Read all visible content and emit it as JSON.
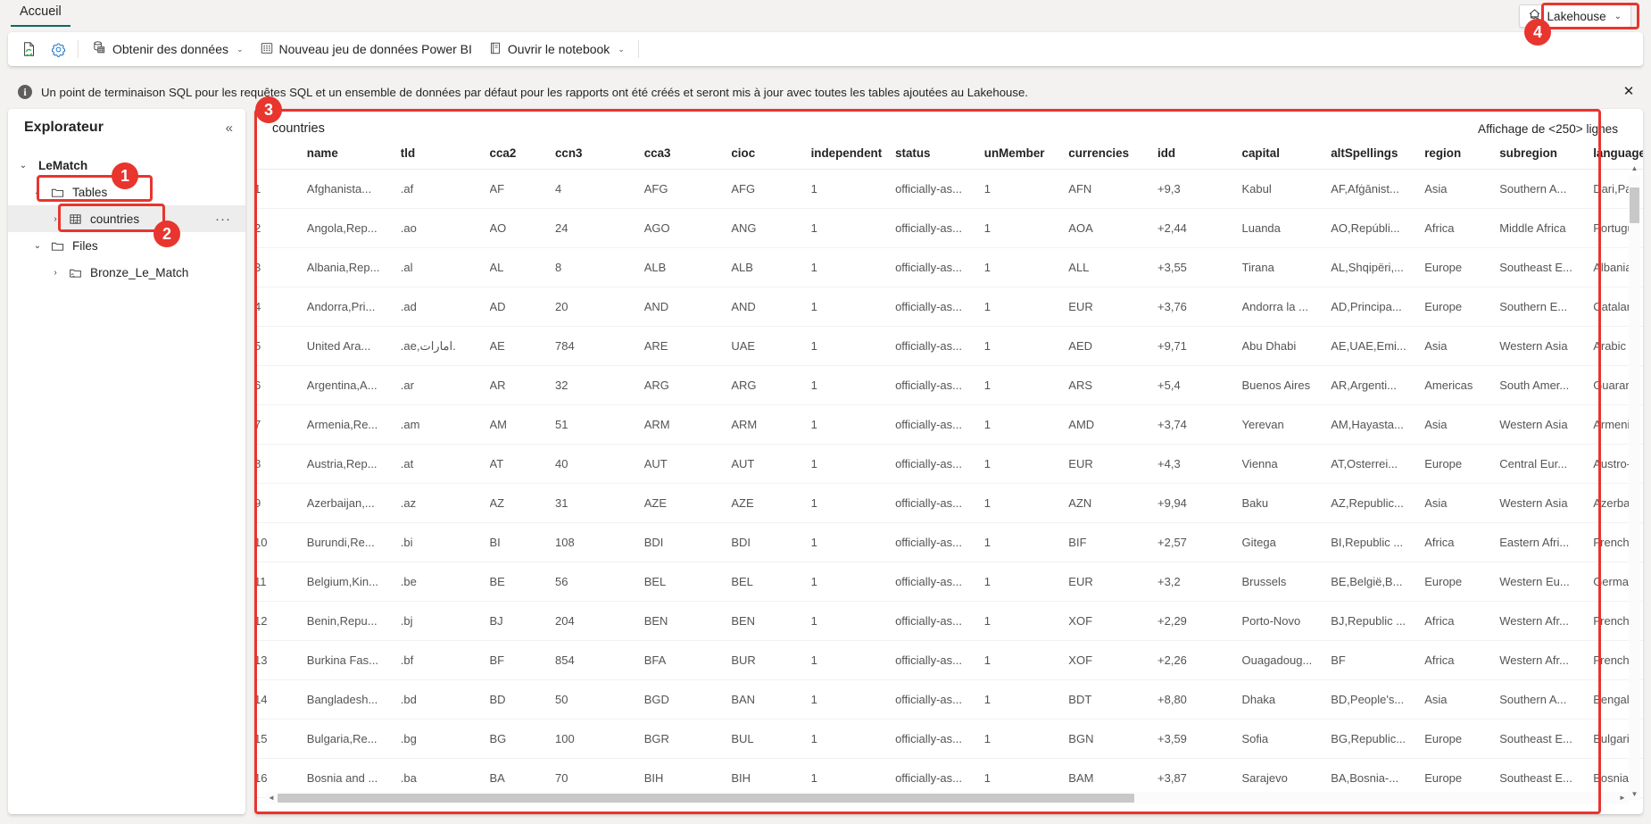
{
  "tabstrip": {
    "home_tab": "Accueil"
  },
  "lakehouse_selector": {
    "label": "Lakehouse",
    "icon": "lakehouse-icon",
    "chevron": "⌄"
  },
  "toolbar": {
    "refresh_icon": "refresh-page-icon",
    "settings_icon": "gear-icon",
    "get_data": {
      "label": "Obtenir des données",
      "icon": "database-icon",
      "chevron": "⌄"
    },
    "new_powerbi_dataset": {
      "label": "Nouveau jeu de données Power BI",
      "icon": "dataset-icon"
    },
    "open_notebook": {
      "label": "Ouvrir le notebook",
      "icon": "notebook-icon",
      "chevron": "⌄"
    }
  },
  "infobar": {
    "icon": "info-icon",
    "message": "Un point de terminaison SQL pour les requêtes SQL et un ensemble de données par défaut pour les rapports ont été créés et seront mis à jour avec toutes les tables ajoutées au Lakehouse.",
    "close_icon": "close-icon"
  },
  "explorer": {
    "title": "Explorateur",
    "collapse_icon": "chevron-double-left-icon",
    "tree": [
      {
        "label": "LeMatch",
        "level": 0,
        "twist": "⌄",
        "icon": "none",
        "selected": false,
        "dots": ""
      },
      {
        "label": "Tables",
        "level": 1,
        "twist": "⌄",
        "icon": "folder-icon",
        "selected": false,
        "dots": ""
      },
      {
        "label": "countries",
        "level": 2,
        "twist": "›",
        "icon": "table-icon",
        "selected": true,
        "dots": "···"
      },
      {
        "label": "Files",
        "level": 1,
        "twist": "⌄",
        "icon": "folder-icon",
        "selected": false,
        "dots": ""
      },
      {
        "label": "Bronze_Le_Match",
        "level": 2,
        "twist": "›",
        "icon": "shortcut-folder-icon",
        "selected": false,
        "dots": ""
      }
    ]
  },
  "preview": {
    "table_name": "countries",
    "row_count_label": "Affichage de <250> lignes",
    "columns": [
      "",
      "name",
      "tld",
      "cca2",
      "ccn3",
      "cca3",
      "cioc",
      "independent",
      "status",
      "unMember",
      "currencies",
      "idd",
      "capital",
      "altSpellings",
      "region",
      "subregion",
      "languages"
    ],
    "rows": [
      [
        "1",
        "Afghanista...",
        ".af",
        "AF",
        "4",
        "AFG",
        "AFG",
        "1",
        "officially-as...",
        "1",
        "AFN",
        "+9,3",
        "Kabul",
        "AF,Afġānist...",
        "Asia",
        "Southern A...",
        "Dari,Pas"
      ],
      [
        "2",
        "Angola,Rep...",
        ".ao",
        "AO",
        "24",
        "AGO",
        "ANG",
        "1",
        "officially-as...",
        "1",
        "AOA",
        "+2,44",
        "Luanda",
        "AO,Repúbli...",
        "Africa",
        "Middle Africa",
        "Portugu"
      ],
      [
        "3",
        "Albania,Rep...",
        ".al",
        "AL",
        "8",
        "ALB",
        "ALB",
        "1",
        "officially-as...",
        "1",
        "ALL",
        "+3,55",
        "Tirana",
        "AL,Shqipëri,...",
        "Europe",
        "Southeast E...",
        "Albania"
      ],
      [
        "4",
        "Andorra,Pri...",
        ".ad",
        "AD",
        "20",
        "AND",
        "AND",
        "1",
        "officially-as...",
        "1",
        "EUR",
        "+3,76",
        "Andorra la ...",
        "AD,Principa...",
        "Europe",
        "Southern E...",
        "Catalan"
      ],
      [
        "5",
        "United Ara...",
        ".ae,امارات.",
        "AE",
        "784",
        "ARE",
        "UAE",
        "1",
        "officially-as...",
        "1",
        "AED",
        "+9,71",
        "Abu Dhabi",
        "AE,UAE,Emi...",
        "Asia",
        "Western Asia",
        "Arabic"
      ],
      [
        "6",
        "Argentina,A...",
        ".ar",
        "AR",
        "32",
        "ARG",
        "ARG",
        "1",
        "officially-as...",
        "1",
        "ARS",
        "+5,4",
        "Buenos Aires",
        "AR,Argenti...",
        "Americas",
        "South Amer...",
        "Guaran"
      ],
      [
        "7",
        "Armenia,Re...",
        ".am",
        "AM",
        "51",
        "ARM",
        "ARM",
        "1",
        "officially-as...",
        "1",
        "AMD",
        "+3,74",
        "Yerevan",
        "AM,Hayasta...",
        "Asia",
        "Western Asia",
        "Armeni"
      ],
      [
        "8",
        "Austria,Rep...",
        ".at",
        "AT",
        "40",
        "AUT",
        "AUT",
        "1",
        "officially-as...",
        "1",
        "EUR",
        "+4,3",
        "Vienna",
        "AT,Osterrei...",
        "Europe",
        "Central Eur...",
        "Austro-"
      ],
      [
        "9",
        "Azerbaijan,...",
        ".az",
        "AZ",
        "31",
        "AZE",
        "AZE",
        "1",
        "officially-as...",
        "1",
        "AZN",
        "+9,94",
        "Baku",
        "AZ,Republic...",
        "Asia",
        "Western Asia",
        "Azerba"
      ],
      [
        "10",
        "Burundi,Re...",
        ".bi",
        "BI",
        "108",
        "BDI",
        "BDI",
        "1",
        "officially-as...",
        "1",
        "BIF",
        "+2,57",
        "Gitega",
        "BI,Republic ...",
        "Africa",
        "Eastern Afri...",
        "French,"
      ],
      [
        "11",
        "Belgium,Kin...",
        ".be",
        "BE",
        "56",
        "BEL",
        "BEL",
        "1",
        "officially-as...",
        "1",
        "EUR",
        "+3,2",
        "Brussels",
        "BE,België,B...",
        "Europe",
        "Western Eu...",
        "Germar"
      ],
      [
        "12",
        "Benin,Repu...",
        ".bj",
        "BJ",
        "204",
        "BEN",
        "BEN",
        "1",
        "officially-as...",
        "1",
        "XOF",
        "+2,29",
        "Porto-Novo",
        "BJ,Republic ...",
        "Africa",
        "Western Afr...",
        "French"
      ],
      [
        "13",
        "Burkina Fas...",
        ".bf",
        "BF",
        "854",
        "BFA",
        "BUR",
        "1",
        "officially-as...",
        "1",
        "XOF",
        "+2,26",
        "Ouagadoug...",
        "BF",
        "Africa",
        "Western Afr...",
        "French"
      ],
      [
        "14",
        "Bangladesh...",
        ".bd",
        "BD",
        "50",
        "BGD",
        "BAN",
        "1",
        "officially-as...",
        "1",
        "BDT",
        "+8,80",
        "Dhaka",
        "BD,People's...",
        "Asia",
        "Southern A...",
        "Bengali"
      ],
      [
        "15",
        "Bulgaria,Re...",
        ".bg",
        "BG",
        "100",
        "BGR",
        "BUL",
        "1",
        "officially-as...",
        "1",
        "BGN",
        "+3,59",
        "Sofia",
        "BG,Republic...",
        "Europe",
        "Southeast E...",
        "Bulgari"
      ],
      [
        "16",
        "Bosnia and ...",
        ".ba",
        "BA",
        "70",
        "BIH",
        "BIH",
        "1",
        "officially-as...",
        "1",
        "BAM",
        "+3,87",
        "Sarajevo",
        "BA,Bosnia-...",
        "Europe",
        "Southeast E...",
        "Bosniar"
      ]
    ]
  },
  "annotations": {
    "accent_color": "#e8352e",
    "badges": [
      {
        "number": "1"
      },
      {
        "number": "2"
      },
      {
        "number": "3"
      },
      {
        "number": "4"
      }
    ]
  }
}
